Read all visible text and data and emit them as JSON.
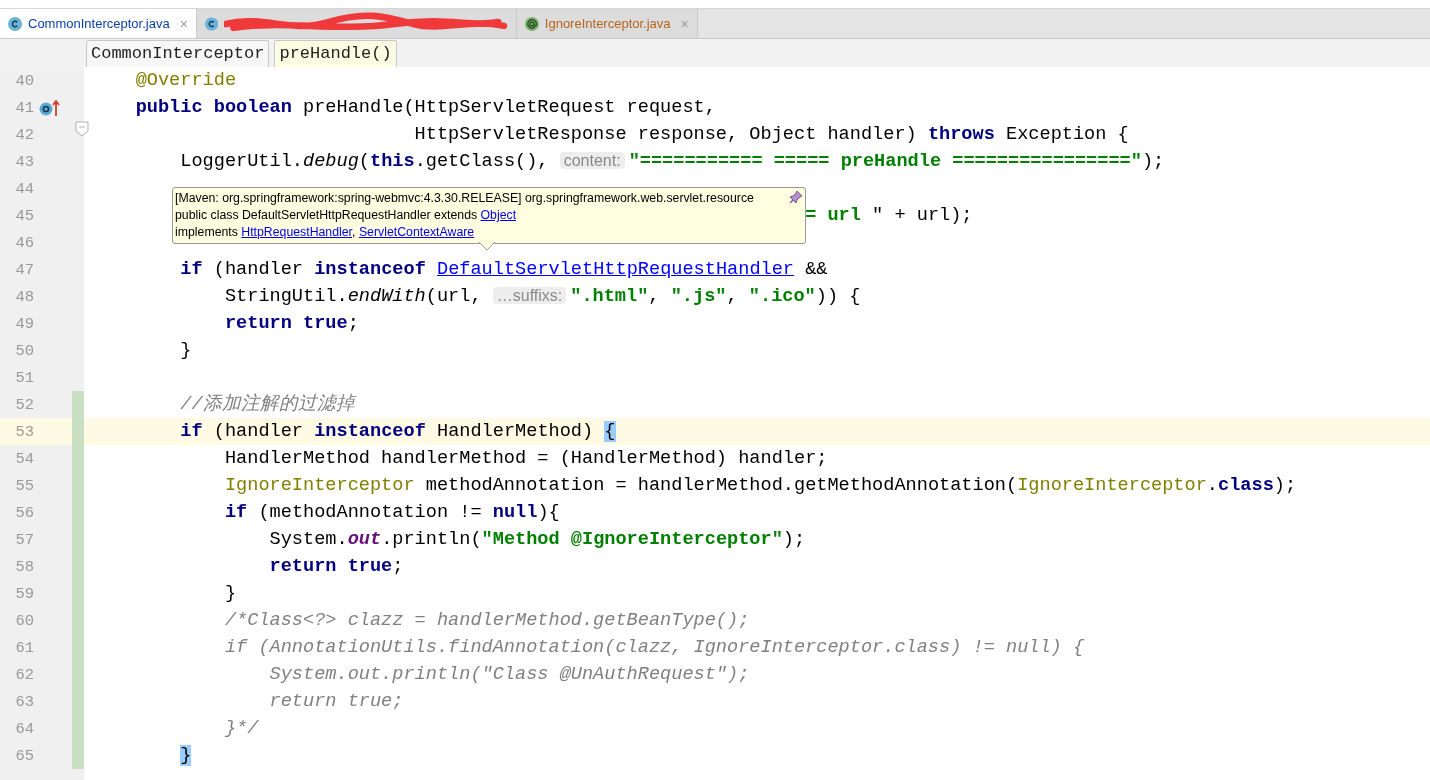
{
  "tabs": [
    {
      "kind": "class",
      "label": "CommonInterceptor.java",
      "close": "×",
      "selected": true
    },
    {
      "kind": "hidden",
      "selected": false
    },
    {
      "kind": "annotation",
      "label": "IgnoreInterceptor.java",
      "close": "×",
      "selected": false
    }
  ],
  "breadcrumb": [
    {
      "label": "CommonInterceptor",
      "selected": false
    },
    {
      "label": "preHandle()",
      "selected": true
    }
  ],
  "lines": [
    {
      "number": "40",
      "current": false,
      "changed": false,
      "tokens": [
        {
          "kind": "annotation",
          "text": "    @Override"
        }
      ]
    },
    {
      "number": "41",
      "current": false,
      "changed": false,
      "kind": "override",
      "tokens": [
        {
          "kind": "keyword",
          "text": "    public boolean"
        },
        {
          "kind": "plain",
          "text": " preHandle(HttpServletRequest request,"
        }
      ]
    },
    {
      "number": "42",
      "current": false,
      "changed": false,
      "kind": "fold",
      "tokens": [
        {
          "kind": "plain",
          "text": "                             HttpServletResponse response, Object handler) "
        },
        {
          "kind": "keyword",
          "text": "throws"
        },
        {
          "kind": "plain",
          "text": " Exception {"
        }
      ]
    },
    {
      "number": "43",
      "current": false,
      "changed": false,
      "tokens": [
        {
          "kind": "plain",
          "text": "        LoggerUtil."
        },
        {
          "kind": "italic",
          "text": "debug"
        },
        {
          "kind": "plain",
          "text": "("
        },
        {
          "kind": "keyword",
          "text": "this"
        },
        {
          "kind": "plain",
          "text": ".getClass(), "
        },
        {
          "kind": "hint",
          "text": "content:"
        },
        {
          "kind": "string",
          "text": "\"=========== ===== preHandle ================\""
        },
        {
          "kind": "plain",
          "text": ");"
        }
      ]
    },
    {
      "number": "44",
      "current": false,
      "changed": false
    },
    {
      "number": "45",
      "current": false,
      "changed": false,
      "tokens": [
        {
          "kind": "string",
          "text": "                                                                = url"
        },
        {
          "kind": "plain",
          "text": " \" + url);"
        }
      ]
    },
    {
      "number": "46",
      "current": false,
      "changed": false
    },
    {
      "number": "47",
      "current": false,
      "changed": false,
      "tokens": [
        {
          "kind": "keyword",
          "text": "        if"
        },
        {
          "kind": "plain",
          "text": " (handler "
        },
        {
          "kind": "keyword",
          "text": "instanceof"
        },
        {
          "kind": "link",
          "text": " DefaultServletHttpRequestHandler"
        },
        {
          "kind": "plain",
          "text": " &&"
        }
      ]
    },
    {
      "number": "48",
      "current": false,
      "changed": false,
      "tokens": [
        {
          "kind": "plain",
          "text": "            StringUtil."
        },
        {
          "kind": "italic",
          "text": "endWith"
        },
        {
          "kind": "plain",
          "text": "(url, "
        },
        {
          "kind": "hint",
          "text": "…suffixs:"
        },
        {
          "kind": "string",
          "text": "\".html\""
        },
        {
          "kind": "plain",
          "text": ", "
        },
        {
          "kind": "string",
          "text": "\".js\""
        },
        {
          "kind": "plain",
          "text": ", "
        },
        {
          "kind": "string",
          "text": "\".ico\""
        },
        {
          "kind": "plain",
          "text": ")) {"
        }
      ]
    },
    {
      "number": "49",
      "current": false,
      "changed": false,
      "tokens": [
        {
          "kind": "keyword",
          "text": "            return true"
        },
        {
          "kind": "plain",
          "text": ";"
        }
      ]
    },
    {
      "number": "50",
      "current": false,
      "changed": false,
      "tokens": [
        {
          "kind": "plain",
          "text": "        }"
        }
      ]
    },
    {
      "number": "51",
      "current": false,
      "changed": false
    },
    {
      "number": "52",
      "current": false,
      "changed": true,
      "tokens": [
        {
          "kind": "comment",
          "text": "        //添加注解的过滤掉"
        }
      ]
    },
    {
      "number": "53",
      "current": true,
      "changed": true,
      "tokens": [
        {
          "kind": "keyword",
          "text": "        if"
        },
        {
          "kind": "plain",
          "text": " (handler "
        },
        {
          "kind": "keyword",
          "text": "instanceof"
        },
        {
          "kind": "plain",
          "text": " HandlerMethod) "
        },
        {
          "kind": "brace",
          "text": "{"
        }
      ]
    },
    {
      "number": "54",
      "current": false,
      "changed": true,
      "tokens": [
        {
          "kind": "plain",
          "text": "            HandlerMethod handlerMethod = (HandlerMethod) handler;"
        }
      ]
    },
    {
      "number": "55",
      "current": false,
      "changed": true,
      "tokens": [
        {
          "kind": "annotation",
          "text": "            IgnoreInterceptor"
        },
        {
          "kind": "plain",
          "text": " methodAnnotation = handlerMethod.getMethodAnnotation("
        },
        {
          "kind": "annotation",
          "text": "IgnoreInterceptor"
        },
        {
          "kind": "plain",
          "text": "."
        },
        {
          "kind": "keyword",
          "text": "class"
        },
        {
          "kind": "plain",
          "text": ");"
        }
      ]
    },
    {
      "number": "56",
      "current": false,
      "changed": true,
      "tokens": [
        {
          "kind": "keyword",
          "text": "            if"
        },
        {
          "kind": "plain",
          "text": " (methodAnnotation != "
        },
        {
          "kind": "keyword",
          "text": "null"
        },
        {
          "kind": "plain",
          "text": "){"
        }
      ]
    },
    {
      "number": "57",
      "current": false,
      "changed": true,
      "tokens": [
        {
          "kind": "plain",
          "text": "                System."
        },
        {
          "kind": "static",
          "text": "out"
        },
        {
          "kind": "plain",
          "text": ".println("
        },
        {
          "kind": "string",
          "text": "\"Method @IgnoreInterceptor\""
        },
        {
          "kind": "plain",
          "text": ");"
        }
      ]
    },
    {
      "number": "58",
      "current": false,
      "changed": true,
      "tokens": [
        {
          "kind": "keyword",
          "text": "                return true"
        },
        {
          "kind": "plain",
          "text": ";"
        }
      ]
    },
    {
      "number": "59",
      "current": false,
      "changed": true,
      "tokens": [
        {
          "kind": "plain",
          "text": "            }"
        }
      ]
    },
    {
      "number": "60",
      "current": false,
      "changed": true,
      "tokens": [
        {
          "kind": "comment",
          "text": "            /*Class<?> clazz = handlerMethod.getBeanType();"
        }
      ]
    },
    {
      "number": "61",
      "current": false,
      "changed": true,
      "tokens": [
        {
          "kind": "comment",
          "text": "            if (AnnotationUtils.findAnnotation(clazz, IgnoreInterceptor.class) != null) {"
        }
      ]
    },
    {
      "number": "62",
      "current": false,
      "changed": true,
      "tokens": [
        {
          "kind": "comment",
          "text": "                System.out.println(\"Class @UnAuthRequest\");"
        }
      ]
    },
    {
      "number": "63",
      "current": false,
      "changed": true,
      "tokens": [
        {
          "kind": "comment",
          "text": "                return true;"
        }
      ]
    },
    {
      "number": "64",
      "current": false,
      "changed": true,
      "tokens": [
        {
          "kind": "comment",
          "text": "            }*/"
        }
      ]
    },
    {
      "number": "65",
      "current": false,
      "changed": true,
      "tokens": [
        {
          "kind": "brace",
          "text": "        }"
        }
      ]
    }
  ],
  "quick_doc": {
    "lines": [
      [
        {
          "text": "[Maven: org.springframework:spring-webmvc:4.3.30.RELEASE] org.springframework.web.servlet.resource",
          "link": false
        }
      ],
      [
        {
          "text": "public class DefaultServletHttpRequestHandler extends ",
          "link": false
        },
        {
          "text": "Object",
          "link": true
        }
      ],
      [
        {
          "text": "implements ",
          "link": false
        },
        {
          "text": "HttpRequestHandler",
          "link": true
        },
        {
          "text": ", ",
          "link": false
        },
        {
          "text": "ServletContextAware",
          "link": true
        }
      ]
    ]
  }
}
